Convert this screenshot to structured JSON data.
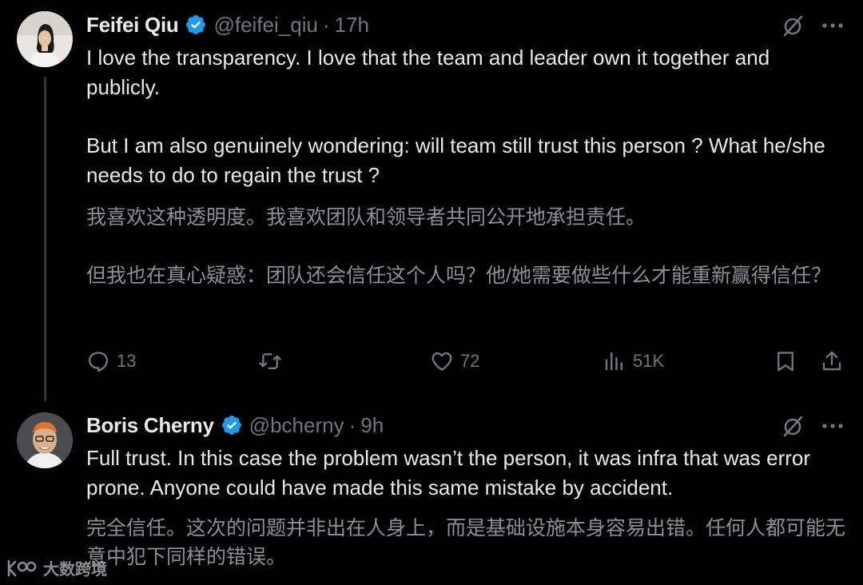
{
  "tweets": [
    {
      "name": "Feifei Qiu",
      "handle": "@feifei_qiu",
      "separator": "·",
      "time": "17h",
      "text_line1": "I love the transparency. I love that the team and leader own it together and publicly.",
      "text_line2": "But I am also genuinely wondering: will team still trust this person ? What he/she needs to do to regain the trust ?",
      "translation_line1": "我喜欢这种透明度。我喜欢团队和领导者共同公开地承担责任。",
      "translation_line2": "但我也在真心疑惑：团队还会信任这个人吗？他/她需要做些什么才能重新赢得信任？",
      "replies": "13",
      "likes": "72",
      "views": "51K"
    },
    {
      "name": "Boris Cherny",
      "handle": "@bcherny",
      "separator": "·",
      "time": "9h",
      "text_line1": "Full trust. In this case the problem wasn’t the person, it was infra that was error prone. Anyone could have made this same mistake by accident.",
      "translation_line1": "完全信任。这次的问题并非出在人身上，而是基础设施本身容易出错。任何人都可能无意中犯下同样的错误。"
    }
  ],
  "watermark": {
    "text": "大数跨境"
  },
  "colors": {
    "verified": "#1d9bf0",
    "muted": "#71767b",
    "text": "#e7e9ea",
    "translation": "#8b9096"
  },
  "icons": [
    "verified-badge-icon",
    "grok-icon",
    "more-icon",
    "reply-icon",
    "retweet-icon",
    "like-icon",
    "views-icon",
    "bookmark-icon",
    "share-icon"
  ]
}
